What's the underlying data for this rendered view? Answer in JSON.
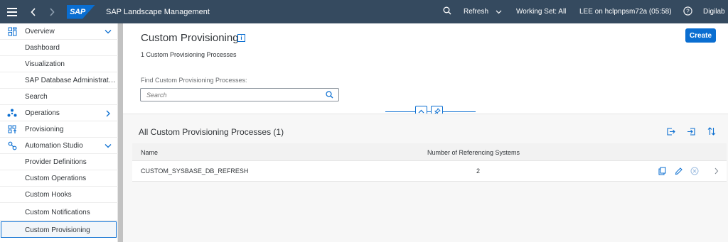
{
  "shell": {
    "app_title": "SAP Landscape Management",
    "logo_text": "SAP",
    "refresh_label": "Refresh",
    "working_set": "Working Set: All",
    "user_info": "LEE on hclpnpsm72a (05:58)",
    "tenant": "Digilab"
  },
  "sidebar": {
    "items": [
      {
        "label": "Overview",
        "icon": "overview-icon",
        "expandable": "down"
      },
      {
        "label": "Dashboard"
      },
      {
        "label": "Visualization"
      },
      {
        "label": "SAP Database Administrati..."
      },
      {
        "label": "Search"
      },
      {
        "label": "Operations",
        "icon": "operations-icon",
        "expandable": "right"
      },
      {
        "label": "Provisioning",
        "icon": "provisioning-icon"
      },
      {
        "label": "Automation Studio",
        "icon": "automation-icon",
        "expandable": "down"
      },
      {
        "label": "Provider Definitions"
      },
      {
        "label": "Custom Operations"
      },
      {
        "label": "Custom Hooks"
      },
      {
        "label": "Custom Notifications"
      },
      {
        "label": "Custom Provisioning",
        "selected": true
      }
    ]
  },
  "main": {
    "title": "Custom Provisioning",
    "create_label": "Create",
    "count_text": "1 Custom Provisioning Processes",
    "find_label": "Find Custom Provisioning Processes:",
    "search_placeholder": "Search",
    "table": {
      "title": "All Custom Provisioning Processes (1)",
      "columns": [
        "Name",
        "Number of Referencing Systems"
      ],
      "rows": [
        {
          "name": "CUSTOM_SYSBASE_DB_REFRESH",
          "count": "2"
        }
      ]
    }
  },
  "colors": {
    "shell_bg": "#354a5f",
    "accent": "#0a6ed1",
    "page_bg": "#f7f7f7"
  }
}
